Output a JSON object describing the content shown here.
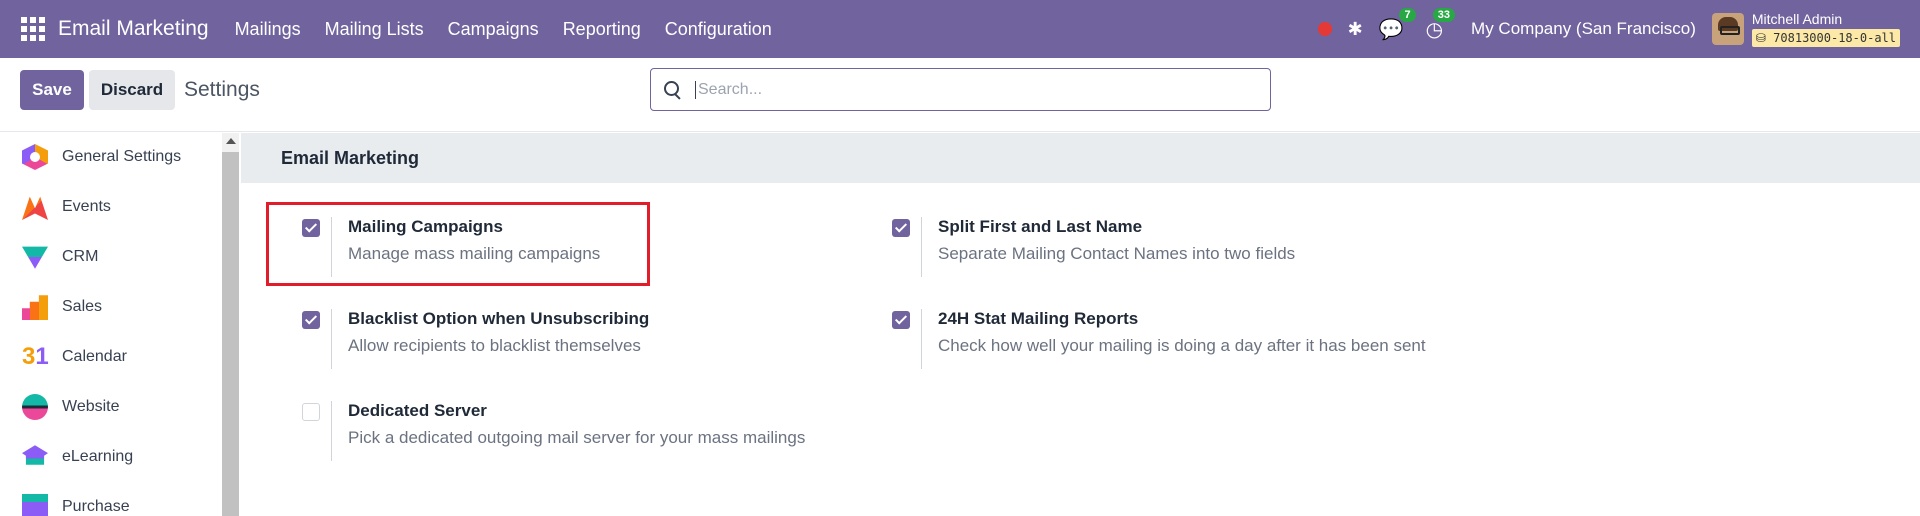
{
  "navbar": {
    "app_name": "Email Marketing",
    "menu": [
      "Mailings",
      "Mailing Lists",
      "Campaigns",
      "Reporting",
      "Configuration"
    ],
    "chat_count": "7",
    "activity_count": "33",
    "company": "My Company (San Francisco)",
    "user_name": "Mitchell Admin",
    "db_name": "70813000-18-0-all"
  },
  "control": {
    "save_label": "Save",
    "discard_label": "Discard",
    "title": "Settings",
    "search_placeholder": "Search..."
  },
  "sidebar": {
    "items": [
      {
        "label": "General Settings",
        "icon": "general-settings-icon"
      },
      {
        "label": "Events",
        "icon": "events-icon"
      },
      {
        "label": "CRM",
        "icon": "crm-icon"
      },
      {
        "label": "Sales",
        "icon": "sales-icon"
      },
      {
        "label": "Calendar",
        "icon": "calendar-icon"
      },
      {
        "label": "Website",
        "icon": "website-icon"
      },
      {
        "label": "eLearning",
        "icon": "elearning-icon"
      },
      {
        "label": "Purchase",
        "icon": "purchase-icon"
      }
    ]
  },
  "section": {
    "title": "Email Marketing",
    "settings": [
      {
        "title": "Mailing Campaigns",
        "description": "Manage mass mailing campaigns",
        "checked": true
      },
      {
        "title": "Split First and Last Name",
        "description": "Separate Mailing Contact Names into two fields",
        "checked": true
      },
      {
        "title": "Blacklist Option when Unsubscribing",
        "description": "Allow recipients to blacklist themselves",
        "checked": true
      },
      {
        "title": "24H Stat Mailing Reports",
        "description": "Check how well your mailing is doing a day after it has been sent",
        "checked": true
      },
      {
        "title": "Dedicated Server",
        "description": "Pick a dedicated outgoing mail server for your mass mailings",
        "checked": false
      }
    ]
  },
  "colors": {
    "brand": "#71639e",
    "highlight": "#e11d2a",
    "badge": "#28a745"
  }
}
